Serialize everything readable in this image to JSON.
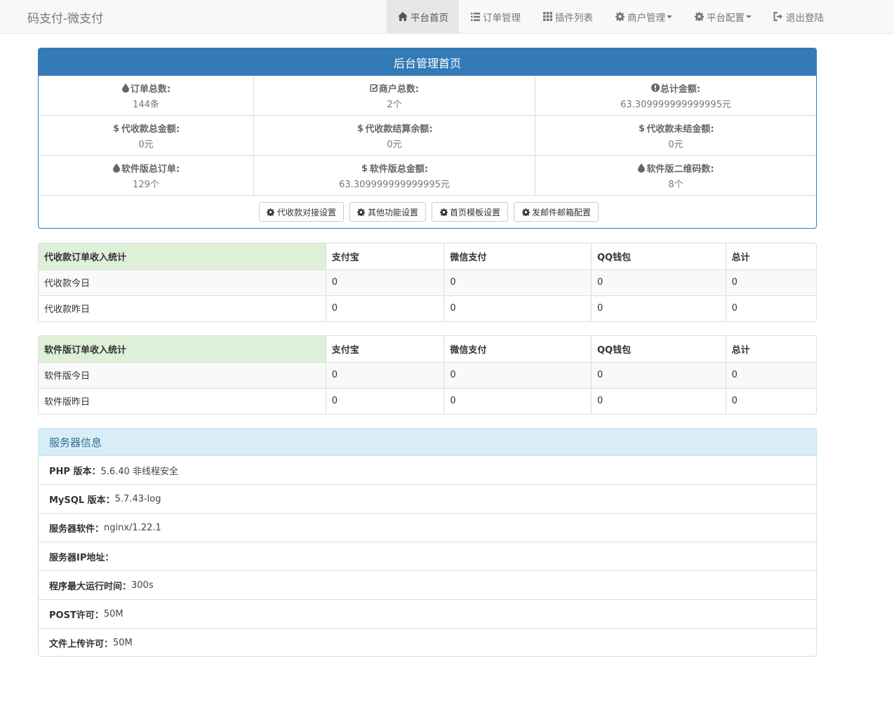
{
  "navbar": {
    "brand": "码支付-微支付",
    "items": [
      {
        "label": "平台首页",
        "icon": "home-icon",
        "active": true
      },
      {
        "label": "订单管理",
        "icon": "list-icon"
      },
      {
        "label": "插件列表",
        "icon": "grid-icon"
      },
      {
        "label": "商户管理",
        "icon": "gear-icon",
        "dropdown": true
      },
      {
        "label": "平台配置",
        "icon": "gear-icon",
        "dropdown": true
      },
      {
        "label": "退出登陆",
        "icon": "logout-icon"
      }
    ]
  },
  "dashboard": {
    "title": "后台管理首页",
    "stats": [
      {
        "label": "订单总数:",
        "value": "144条",
        "icon": "drop-icon"
      },
      {
        "label": "商户总数:",
        "value": "2个",
        "icon": "check-square-icon"
      },
      {
        "label": "总计金额:",
        "value": "63.309999999999995元",
        "icon": "info-circle-icon"
      },
      {
        "label": "代收款总金额:",
        "value": "0元",
        "icon": "dollar-icon"
      },
      {
        "label": "代收款结算余额:",
        "value": "0元",
        "icon": "dollar-icon"
      },
      {
        "label": "代收款未结金额:",
        "value": "0元",
        "icon": "dollar-icon"
      },
      {
        "label": "软件版总订单:",
        "value": "129个",
        "icon": "drop-icon"
      },
      {
        "label": "软件版总金额:",
        "value": "63.309999999999995元",
        "icon": "dollar-icon"
      },
      {
        "label": "软件版二维码数:",
        "value": "8个",
        "icon": "drop-icon"
      }
    ],
    "buttons": [
      "代收款对接设置",
      "其他功能设置",
      "首页模板设置",
      "发邮件邮箱配置"
    ]
  },
  "collect_table": {
    "headers": [
      "代收款订单收入统计",
      "支付宝",
      "微信支付",
      "QQ钱包",
      "总计"
    ],
    "rows": [
      [
        "代收款今日",
        "0",
        "0",
        "0",
        "0"
      ],
      [
        "代收款昨日",
        "0",
        "0",
        "0",
        "0"
      ]
    ]
  },
  "software_table": {
    "headers": [
      "软件版订单收入统计",
      "支付宝",
      "微信支付",
      "QQ钱包",
      "总计"
    ],
    "rows": [
      [
        "软件版今日",
        "0",
        "0",
        "0",
        "0"
      ],
      [
        "软件版昨日",
        "0",
        "0",
        "0",
        "0"
      ]
    ]
  },
  "server_info": {
    "title": "服务器信息",
    "rows": [
      {
        "label": "PHP 版本：",
        "value": "5.6.40 非线程安全"
      },
      {
        "label": "MySQL 版本：",
        "value": "5.7.43-log"
      },
      {
        "label": "服务器软件：",
        "value": "nginx/1.22.1"
      },
      {
        "label": "服务器IP地址：",
        "value": ""
      },
      {
        "label": "程序最大运行时间：",
        "value": "300s"
      },
      {
        "label": "POST许可：",
        "value": "50M"
      },
      {
        "label": "文件上传许可：",
        "value": "50M"
      }
    ]
  },
  "colors": {
    "primary": "#337ab7",
    "success_bg": "#dff0d8",
    "info_bg": "#d9edf7",
    "info_text": "#31708f"
  }
}
